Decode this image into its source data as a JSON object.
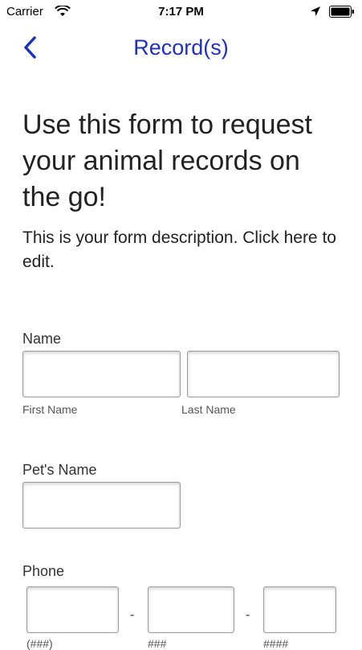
{
  "status_bar": {
    "carrier": "Carrier",
    "time": "7:17 PM"
  },
  "nav": {
    "title": "Record(s)"
  },
  "form": {
    "title": "Use this form to request your animal records on the go!",
    "description": "This is your form description. Click here to edit."
  },
  "fields": {
    "name": {
      "label": "Name",
      "first_sublabel": "First Name",
      "last_sublabel": "Last Name"
    },
    "pet_name": {
      "label": "Pet's Name"
    },
    "phone": {
      "label": "Phone",
      "separator": "-",
      "area_sublabel": "(###)",
      "prefix_sublabel": "###",
      "line_sublabel": "####"
    }
  },
  "colors": {
    "accent": "#1c2fcc"
  }
}
